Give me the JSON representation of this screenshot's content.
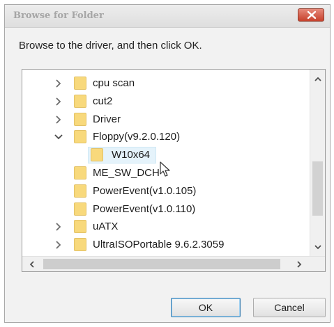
{
  "window": {
    "title": "Browse for Folder",
    "close_icon": "close-icon"
  },
  "instruction": "Browse to the driver, and then click OK.",
  "tree": {
    "items": [
      {
        "label": "cpu scan",
        "expander": "chevron-right",
        "selected": false
      },
      {
        "label": "cut2",
        "expander": "chevron-right",
        "selected": false
      },
      {
        "label": "Driver",
        "expander": "chevron-right",
        "selected": false
      },
      {
        "label": "Floppy(v9.2.0.120)",
        "expander": "chevron-down",
        "selected": false
      },
      {
        "label": "W10x64",
        "expander": "none",
        "selected": true
      },
      {
        "label": "ME_SW_DCH",
        "expander": "none",
        "selected": false
      },
      {
        "label": "PowerEvent(v1.0.105)",
        "expander": "none",
        "selected": false
      },
      {
        "label": "PowerEvent(v1.0.110)",
        "expander": "none",
        "selected": false
      },
      {
        "label": "uATX",
        "expander": "chevron-right",
        "selected": false
      },
      {
        "label": "UltraISOPortable 9.6.2.3059",
        "expander": "chevron-right",
        "selected": false
      }
    ]
  },
  "buttons": {
    "ok": "OK",
    "cancel": "Cancel"
  },
  "colors": {
    "folder": "#f8d97c",
    "selection": "#e5f3fb",
    "close_button": "#c7412c",
    "default_button_border": "#3c7fb1"
  }
}
